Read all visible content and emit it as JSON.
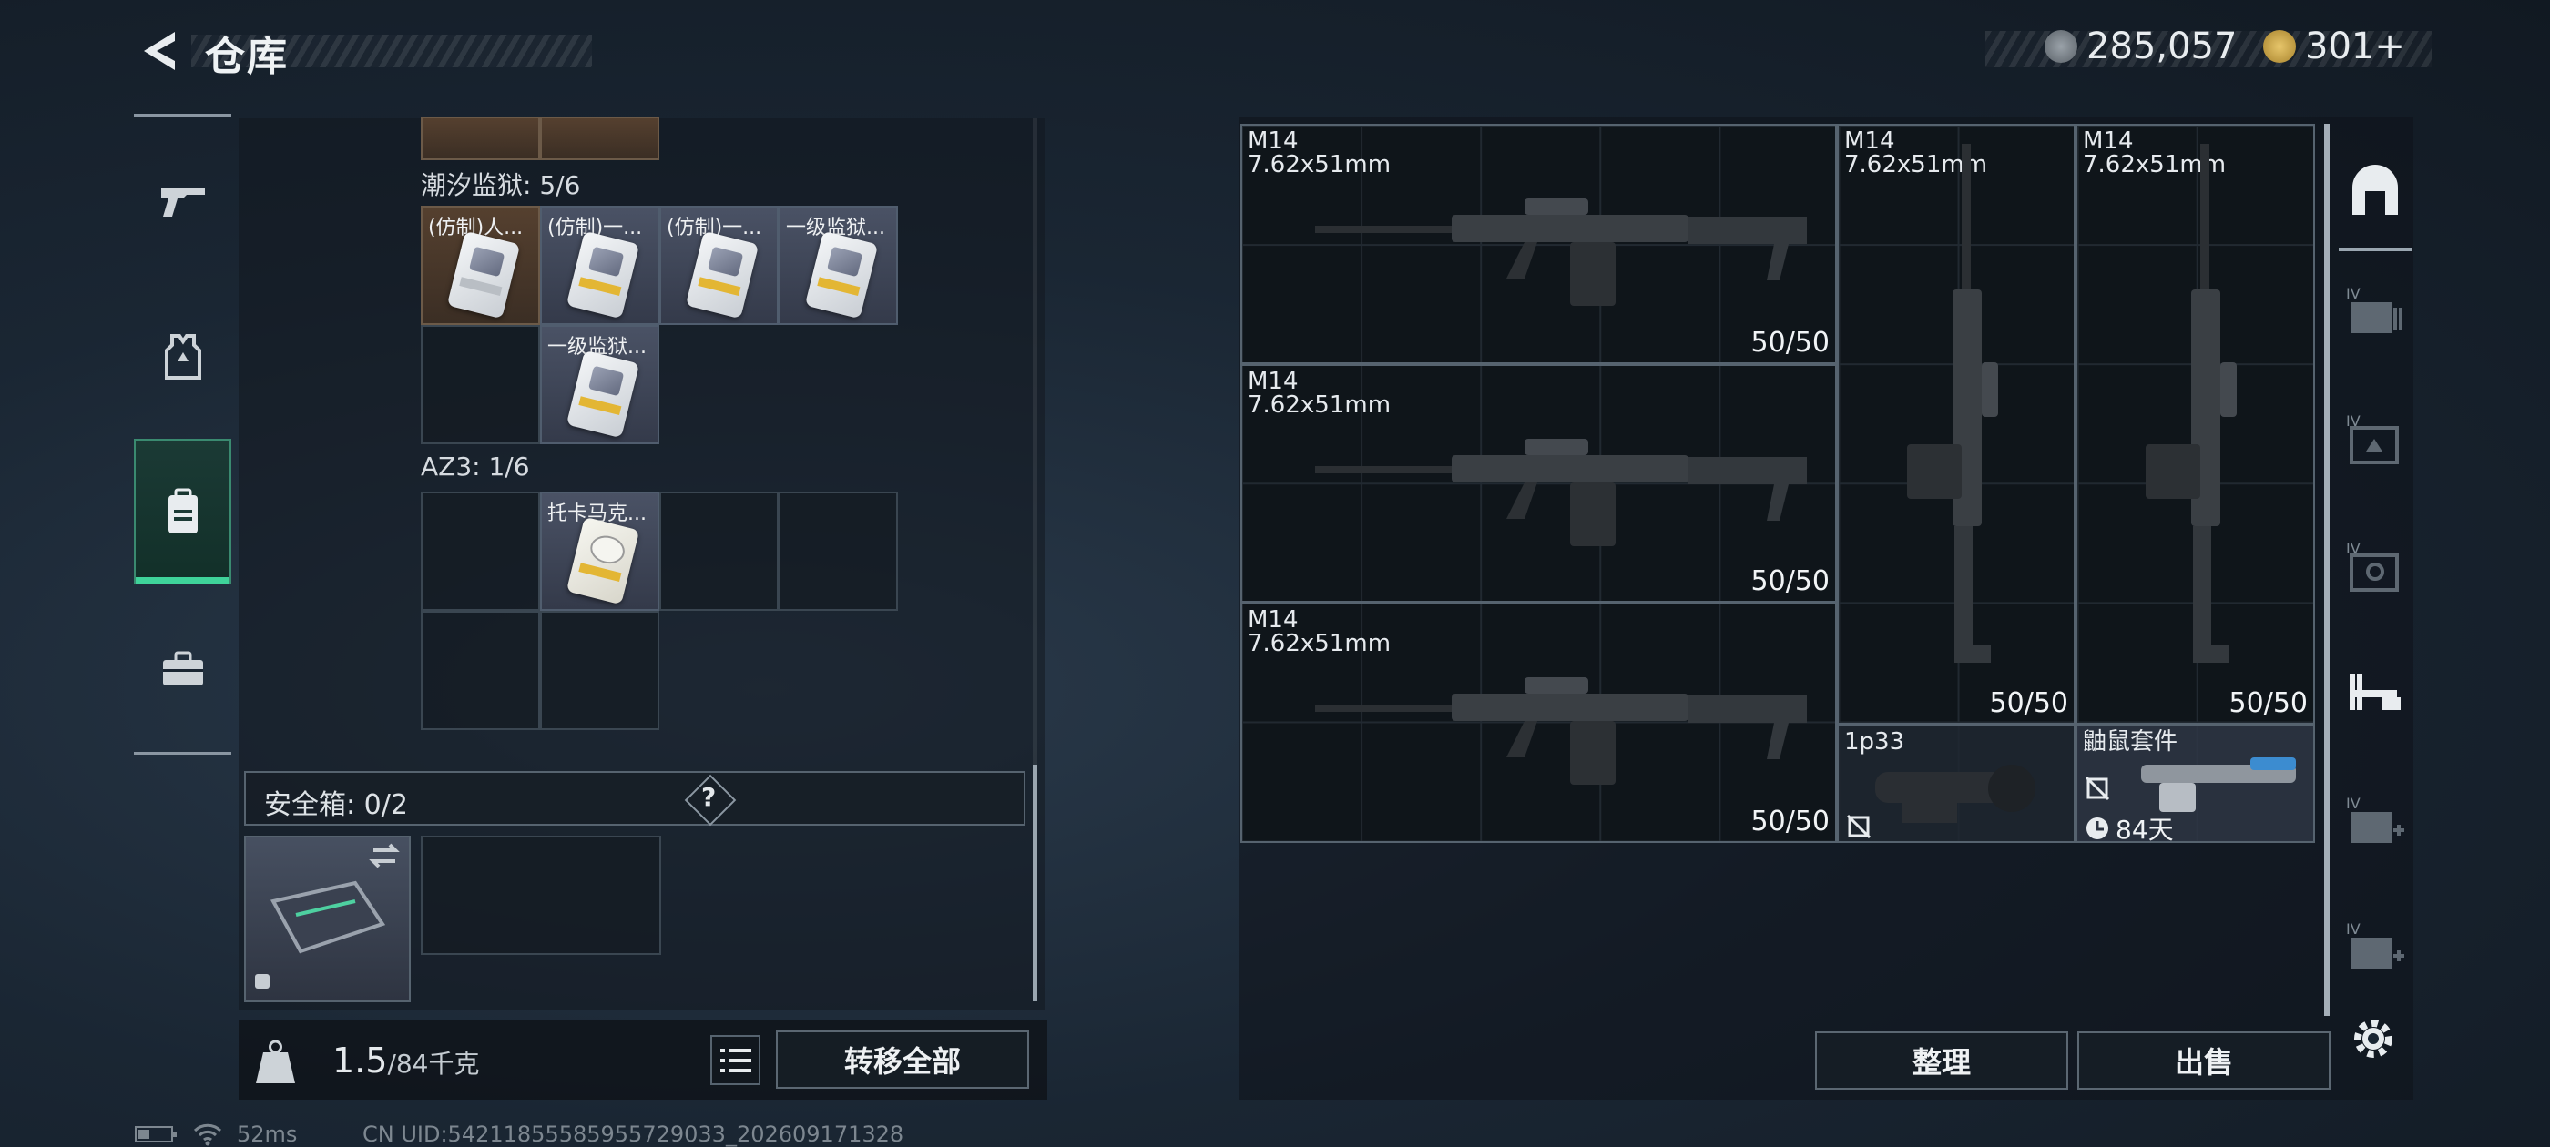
{
  "header": {
    "title": "仓库",
    "currency_silver": "285,057",
    "currency_gold": "301+"
  },
  "left_panel": {
    "section1_label": "潮汐监狱: 5/6",
    "section1_items": [
      "(仿制)人...",
      "(仿制)一...",
      "(仿制)一...",
      "一级监狱...",
      "一级监狱..."
    ],
    "section2_label": "AZ3: 1/6",
    "section2_items": [
      "托卡马克..."
    ],
    "safebox_label": "安全箱: 0/2",
    "safebox_help": "?",
    "weight_current": "1.5",
    "weight_max": "/84千克",
    "transfer_all": "转移全部"
  },
  "right_panel": {
    "weapons": [
      {
        "name": "M14",
        "caliber": "7.62x51mm",
        "ammo": "50/50"
      },
      {
        "name": "M14",
        "caliber": "7.62x51mm",
        "ammo": "50/50"
      },
      {
        "name": "M14",
        "caliber": "7.62x51mm",
        "ammo": "50/50"
      },
      {
        "name": "M14",
        "caliber": "7.62x51mm",
        "ammo": "50/50"
      },
      {
        "name": "M14",
        "caliber": "7.62x51mm",
        "ammo": "50/50"
      }
    ],
    "attachments": [
      {
        "name": "1p33"
      },
      {
        "name": "鼬鼠套件",
        "timer": "84天"
      }
    ],
    "sort_button": "整理",
    "sell_button": "出售"
  },
  "status_bar": {
    "ping": "52ms",
    "uid": "CN UID:54211855585955729033_202609171328"
  },
  "colors": {
    "accent_green": "#3fd39a",
    "panel_border": "#56636f"
  }
}
